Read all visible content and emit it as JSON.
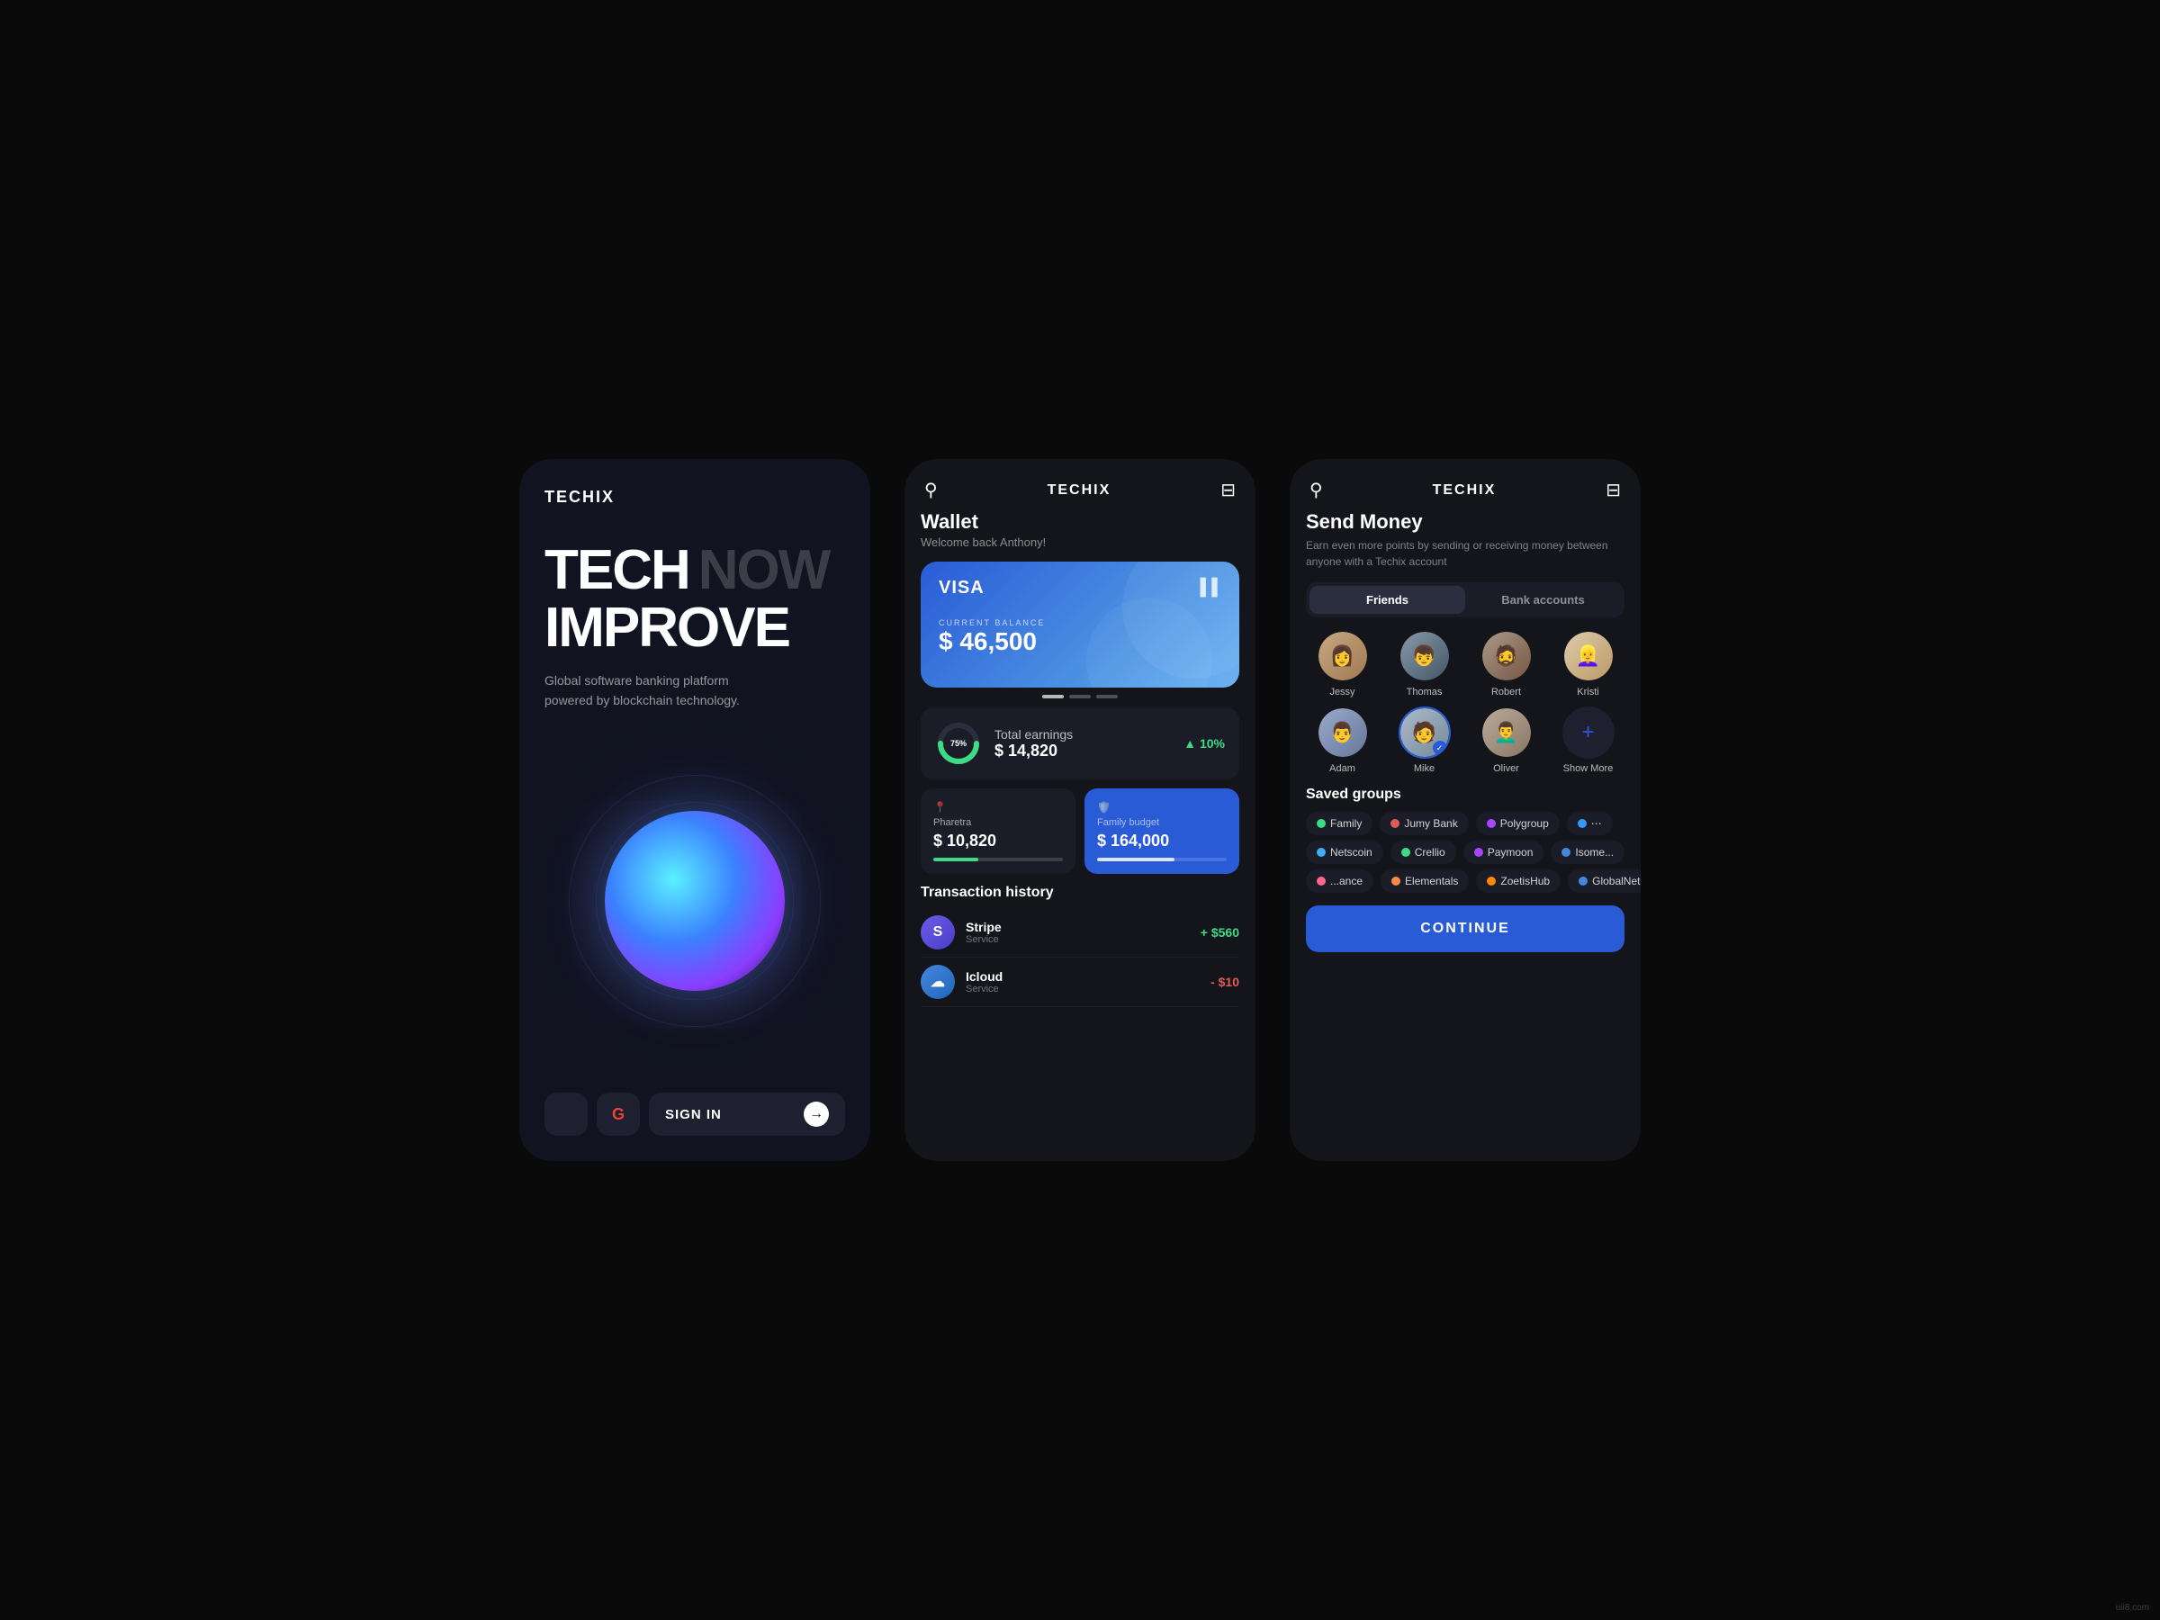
{
  "screen1": {
    "logo": "TECHIX",
    "hero_line1_bold": "TECH",
    "hero_line1_faded": "NOW",
    "hero_line2": "IMPROVE",
    "subtitle": "Global software banking platform powered by blockchain technology.",
    "signin_label": "SIGN IN"
  },
  "screen2": {
    "logo": "TECHIX",
    "wallet_title": "Wallet",
    "wallet_sub": "Welcome back Anthony!",
    "card": {
      "brand": "VISA",
      "balance_label": "CURRENT BALANCE",
      "balance": "$ 46,500"
    },
    "earnings": {
      "label": "Total earnings",
      "amount": "$ 14,820",
      "pct": "▲ 10%",
      "donut_pct": "75%"
    },
    "budgets": [
      {
        "icon": "📍",
        "name": "Pharetra",
        "amount": "$ 10,820",
        "progress": 35,
        "type": "normal"
      },
      {
        "icon": "🛡️",
        "name": "Family budget",
        "amount": "$ 164,000",
        "progress": 60,
        "type": "active"
      }
    ],
    "tx_title": "Transaction history",
    "transactions": [
      {
        "name": "Stripe",
        "sub": "Service",
        "amount": "+ $560",
        "sign": "pos",
        "color": "#6a5de8",
        "initial": "S"
      },
      {
        "name": "Icloud",
        "sub": "Service",
        "amount": "- $10",
        "sign": "neg",
        "color": "#4488dd",
        "initial": "☁"
      }
    ]
  },
  "screen3": {
    "logo": "TECHIX",
    "send_title": "Send Money",
    "send_sub": "Earn even more points by sending or receiving money between anyone with a Techix account",
    "tabs": [
      {
        "label": "Friends",
        "active": true
      },
      {
        "label": "Bank accounts",
        "active": false
      }
    ],
    "friends": [
      {
        "name": "Jessy",
        "selected": false,
        "color": "av-jessy"
      },
      {
        "name": "Thomas",
        "selected": false,
        "color": "av-thomas"
      },
      {
        "name": "Robert",
        "selected": false,
        "color": "av-robert"
      },
      {
        "name": "Kristi",
        "selected": false,
        "color": "av-kristi"
      },
      {
        "name": "Adam",
        "selected": false,
        "color": "av-adam"
      },
      {
        "name": "Mike",
        "selected": true,
        "color": "av-mike"
      },
      {
        "name": "Oliver",
        "selected": false,
        "color": "av-oliver"
      },
      {
        "name": "Show More",
        "selected": false,
        "color": "",
        "isAdd": true
      }
    ],
    "groups_title": "Saved groups",
    "groups_rows": [
      [
        {
          "label": "Family",
          "color": "#3ddc84"
        },
        {
          "label": "Jumy Bank",
          "color": "#e05a5a"
        },
        {
          "label": "Polygroup",
          "color": "#aa44ff"
        },
        {
          "label": "...",
          "color": "#3399ff"
        }
      ],
      [
        {
          "label": "Netscoin",
          "color": "#44aaff"
        },
        {
          "label": "Crellio",
          "color": "#3ddc84"
        },
        {
          "label": "Paymoon",
          "color": "#aa44ff"
        },
        {
          "label": "Isome...",
          "color": "#4488dd"
        }
      ],
      [
        {
          "label": "...ance",
          "color": "#ff6688"
        },
        {
          "label": "Elementals",
          "color": "#ff8844"
        },
        {
          "label": "ZoetisHub",
          "color": "#ff8800"
        },
        {
          "label": "GlobalNet...",
          "color": "#4488dd"
        }
      ]
    ],
    "continue_label": "CONTINUE"
  }
}
